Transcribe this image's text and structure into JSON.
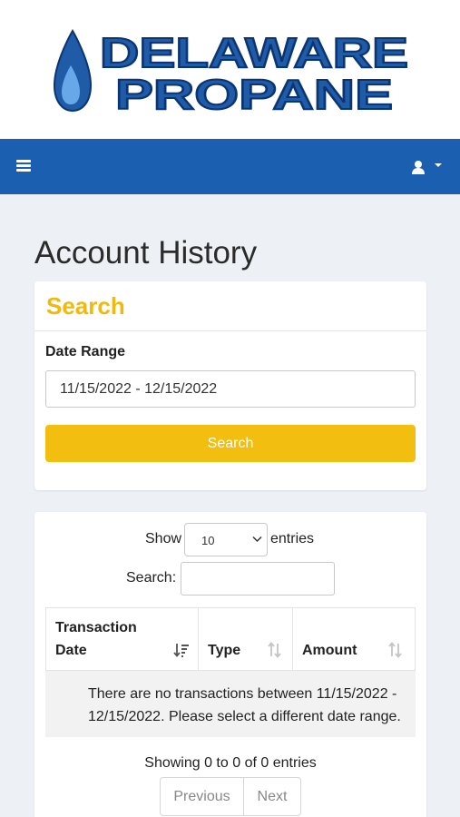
{
  "header": {
    "logo_line1": "DELAWARE",
    "logo_line2": "PROPANE",
    "colors": {
      "navbar": "#1a5fb0",
      "logo_blue": "#1f5ba6",
      "accent_yellow": "#f2be0f"
    },
    "icons": {
      "menu": "hamburger-icon",
      "user": "user-icon",
      "caret": "caret-down-icon"
    }
  },
  "page": {
    "title": "Account History"
  },
  "search_card": {
    "title": "Search",
    "date_range_label": "Date Range",
    "date_range_value": "11/15/2022 - 12/15/2022",
    "search_button": "Search"
  },
  "table_card": {
    "show_label": "Show",
    "entries_value": "10",
    "entries_label": "entries",
    "search_label": "Search:",
    "search_value": "",
    "columns": [
      "Transaction Date",
      "Type",
      "Amount"
    ],
    "col0_line1": "Transaction",
    "col0_line2": "Date",
    "empty_message": "There are no transactions between 11/15/2022 - 12/15/2022. Please select a different date range.",
    "info": "Showing 0 to 0 of 0 entries",
    "prev": "Previous",
    "next": "Next"
  }
}
